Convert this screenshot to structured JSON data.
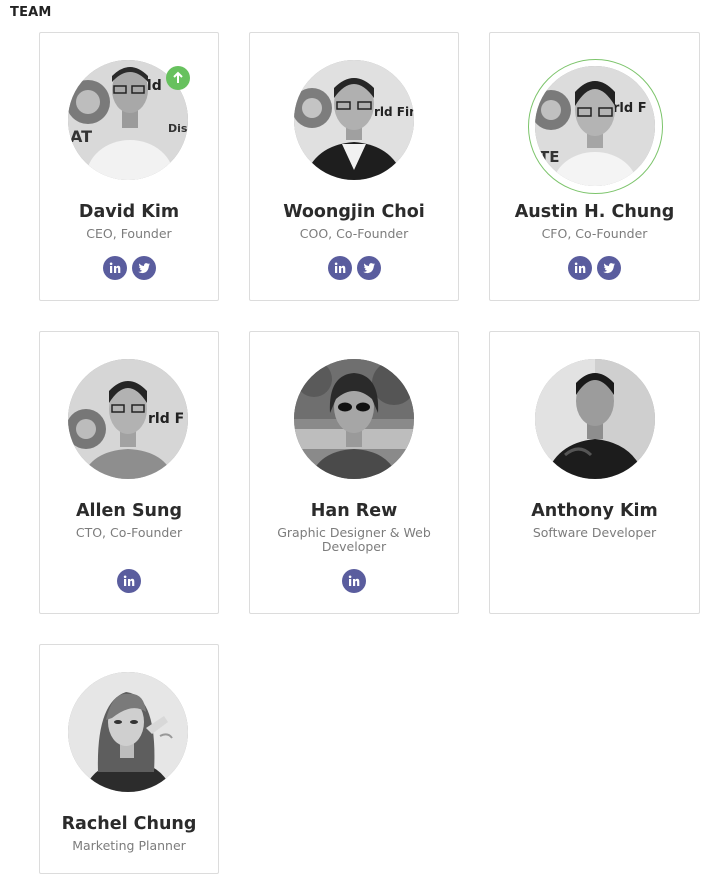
{
  "section": {
    "title": "TEAM"
  },
  "members": [
    {
      "name": "David Kim",
      "role": "CEO, Founder",
      "social": [
        "linkedin-icon",
        "twitter-icon"
      ]
    },
    {
      "name": "Woongjin Choi",
      "role": "COO, Co-Founder",
      "social": [
        "linkedin-icon",
        "twitter-icon"
      ]
    },
    {
      "name": "Austin H. Chung",
      "role": "CFO, Co-Founder",
      "social": [
        "linkedin-icon",
        "twitter-icon"
      ]
    },
    {
      "name": "Allen Sung",
      "role": "CTO, Co-Founder",
      "social": [
        "linkedin-icon"
      ]
    },
    {
      "name": "Han Rew",
      "role_line1": "Graphic Designer & Web",
      "role_line2": "Developer",
      "social": [
        "linkedin-icon"
      ]
    },
    {
      "name": "Anthony Kim",
      "role": "Software Developer",
      "social": []
    },
    {
      "name": "Rachel Chung",
      "role": "Marketing Planner",
      "social": []
    }
  ],
  "colors": {
    "social_button": "#5a5d9e",
    "badge_green": "#67c15e",
    "ring_green": "#7cc46b",
    "card_border": "#dcdcdc"
  },
  "icons": {
    "scroll_top": "arrow-up-icon"
  }
}
